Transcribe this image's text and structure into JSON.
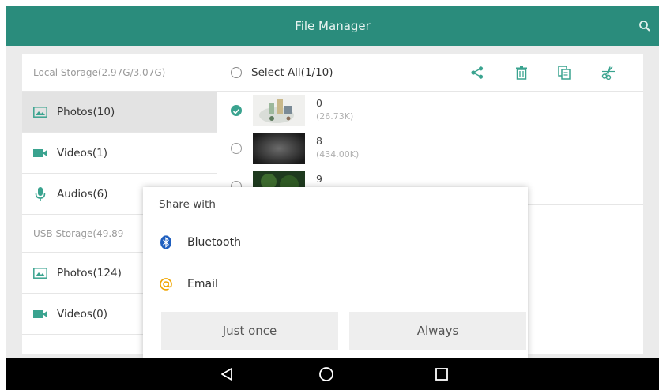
{
  "app": {
    "title": "File Manager"
  },
  "sidebar": {
    "local_header": "Local Storage(2.97G/3.07G)",
    "usb_header": "USB Storage(49.89",
    "items": [
      {
        "label": "Photos(10)",
        "icon": "image-icon"
      },
      {
        "label": "Videos(1)",
        "icon": "video-camera-icon"
      },
      {
        "label": "Audios(6)",
        "icon": "microphone-icon"
      }
    ],
    "usb_items": [
      {
        "label": "Photos(124)",
        "icon": "image-icon"
      },
      {
        "label": "Videos(0)",
        "icon": "video-camera-icon"
      }
    ]
  },
  "main": {
    "select_all_label": "Select All(1/10)",
    "tools": [
      "share-icon",
      "trash-icon",
      "copy-icon",
      "cut-icon"
    ],
    "files": [
      {
        "name": "0",
        "size": "(26.73K)",
        "checked": true
      },
      {
        "name": "8",
        "size": "(434.00K)",
        "checked": false
      },
      {
        "name": "9",
        "size": "",
        "checked": false
      }
    ]
  },
  "dialog": {
    "title": "Share with",
    "options": [
      {
        "label": "Bluetooth",
        "icon": "bluetooth-icon"
      },
      {
        "label": "Email",
        "icon": "at-sign-icon"
      }
    ],
    "just_once": "Just once",
    "always": "Always"
  },
  "navbar": {
    "buttons": [
      "back-triangle-icon",
      "home-circle-icon",
      "recents-square-icon"
    ]
  },
  "colors": {
    "accent": "#2a8c7c",
    "check": "#3aa38f",
    "email_icon": "#f0a500",
    "bluetooth_icon": "#1f5fbf"
  }
}
